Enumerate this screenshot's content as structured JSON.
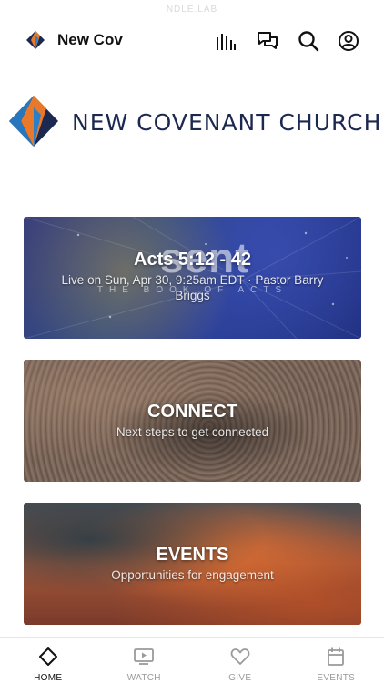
{
  "status_bar": {
    "text": "NDLE.LAB"
  },
  "header": {
    "app_title": "New Cov",
    "icons": [
      "sound-bars-icon",
      "chat-bubbles-icon",
      "search-icon",
      "profile-icon"
    ]
  },
  "brand": {
    "name": "NEW COVENANT CHURCH",
    "colors": {
      "navy": "#1b2850",
      "orange": "#e8782a",
      "blue": "#2a7fc9"
    }
  },
  "cards": [
    {
      "id": "watch",
      "title": "Acts 5:12 - 42",
      "subtitle": "Live on Sun, Apr 30, 9:25am EDT · Pastor Barry Briggs",
      "overlay_word": "sent",
      "overlay_series": "THE BOOK OF ACTS"
    },
    {
      "id": "connect",
      "title": "CONNECT",
      "subtitle": "Next steps to get connected"
    },
    {
      "id": "events",
      "title": "EVENTS",
      "subtitle": "Opportunities for engagement"
    }
  ],
  "tab_bar": {
    "tabs": [
      {
        "label": "HOME",
        "icon": "home-diamond-icon",
        "active": true
      },
      {
        "label": "WATCH",
        "icon": "play-screen-icon",
        "active": false
      },
      {
        "label": "GIVE",
        "icon": "heart-icon",
        "active": false
      },
      {
        "label": "EVENTS",
        "icon": "calendar-icon",
        "active": false
      }
    ]
  }
}
